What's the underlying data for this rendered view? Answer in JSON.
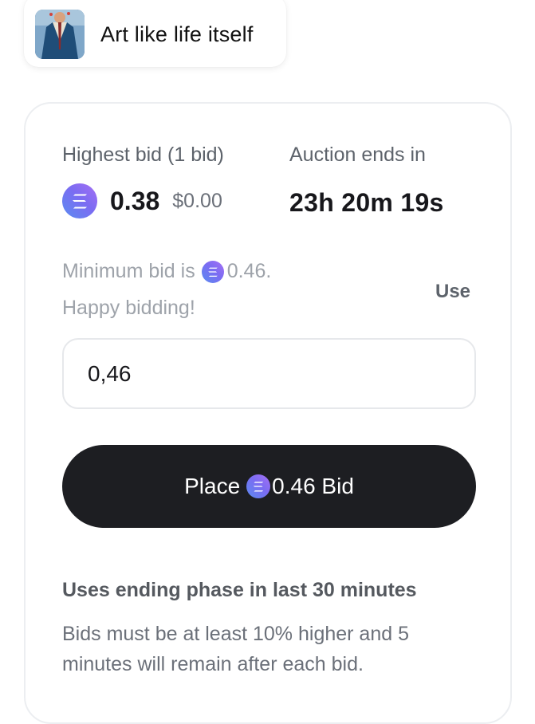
{
  "collection": {
    "name": "Art like life itself",
    "thumbnail_icon": "artwork-thumbnail"
  },
  "auction": {
    "highest_bid_label": "Highest bid (1 bid)",
    "ends_label": "Auction ends in",
    "currency_icon": "solana-icon",
    "highest_bid_amount": "0.38",
    "highest_bid_usd": "$0.00",
    "countdown": "23h 20m 19s"
  },
  "bid_form": {
    "min_bid_prefix": "Minimum bid is",
    "min_bid_amount": "0.46.",
    "happy_text": "Happy bidding!",
    "use_label": "Use",
    "input_value": "0,46",
    "button_prefix": "Place",
    "button_amount": "0.46 Bid"
  },
  "ending_phase": {
    "title": "Uses ending phase in last 30 minutes",
    "description": "Bids must be at least 10% higher and 5 minutes will remain after each bid."
  },
  "colors": {
    "button_bg": "#1d1e22",
    "solana_gradient_start": "#9945ff",
    "solana_gradient_end": "#14f195"
  }
}
